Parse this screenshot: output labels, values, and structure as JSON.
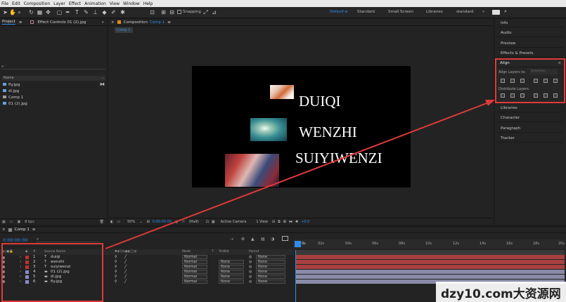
{
  "menu": [
    "File",
    "Edit",
    "Composition",
    "Layer",
    "Effect",
    "Animation",
    "View",
    "Window",
    "Help"
  ],
  "toolbar": {
    "snapping": "Snapping",
    "workspaces": [
      "Default",
      "Standard",
      "Small Screen",
      "Libraries",
      "standard"
    ]
  },
  "project_panel": {
    "tab": "Project",
    "effects_tab": "Effect Controls 01 (2).jpg",
    "name_header": "Name",
    "items": [
      "fly.jpg",
      "di.jpg",
      "Comp 1",
      "01 (2).jpg"
    ],
    "bpc": "8 bpc"
  },
  "comp_panel": {
    "tab": "Composition",
    "comp_name": "Comp 1",
    "comp_tab": "Comp 1",
    "zoom": "50%",
    "time": "0:00:00:00",
    "resolution": "(Half)",
    "camera": "Active Camera",
    "view": "1 View",
    "exposure": "+0.0"
  },
  "canvas_text": {
    "line1": "DUIQI",
    "line2": "WENZHI",
    "line3": "SUIYIWENZI"
  },
  "right_panel": {
    "items_top": [
      "Info",
      "Audio",
      "Preview",
      "Effects & Presets"
    ],
    "align_title": "Align",
    "align_layers_to": "Align Layers to:",
    "align_target": "Selection",
    "distribute_title": "Distribute Layers:",
    "items_bottom": [
      "Libraries",
      "Character",
      "Paragraph",
      "Tracker"
    ]
  },
  "timeline": {
    "tab": "Comp 1",
    "timecode": "0:00:00:00",
    "col_hash": "#",
    "col_source": "Source Name",
    "col_mode": "Mode",
    "col_t": "T",
    "col_trkmat": "TrkMat",
    "col_parent": "Parent",
    "layers": [
      {
        "num": "1",
        "name": "duiqi",
        "type": "T",
        "mode": "Normal",
        "trkmat": "",
        "parent": "None",
        "color": "#c03030"
      },
      {
        "num": "2",
        "name": "wenzhi",
        "type": "T",
        "mode": "Normal",
        "trkmat": "None",
        "parent": "None",
        "color": "#c03030"
      },
      {
        "num": "3",
        "name": "suiyiwenzi",
        "type": "T",
        "mode": "Normal",
        "trkmat": "None",
        "parent": "None",
        "color": "#c03030"
      },
      {
        "num": "4",
        "name": "01 (2).jpg",
        "type": "img",
        "mode": "Normal",
        "trkmat": "None",
        "parent": "None",
        "color": "#8a8ac8"
      },
      {
        "num": "5",
        "name": "di.jpg",
        "type": "img",
        "mode": "Normal",
        "trkmat": "None",
        "parent": "None",
        "color": "#8a8ac8"
      },
      {
        "num": "6",
        "name": "fly.jpg",
        "type": "img",
        "mode": "Normal",
        "trkmat": "None",
        "parent": "None",
        "color": "#8a8ac8"
      }
    ],
    "ruler": [
      "0s",
      "02s",
      "04s",
      "06s",
      "08s",
      "10s",
      "12s",
      "14s",
      "16s",
      "18s",
      "20s"
    ]
  },
  "watermark": "dzy10.com大资源网",
  "colors": {
    "accent": "#2d8ceb",
    "annotation": "#e03a3a",
    "text_track": "#a84040",
    "image_track": "#8a8aa8"
  }
}
